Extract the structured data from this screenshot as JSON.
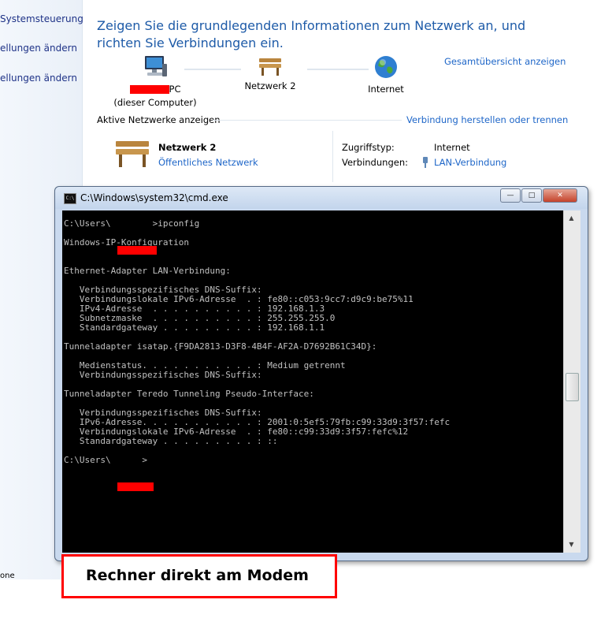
{
  "sidebar": {
    "items": [
      {
        "label": "Systemsteuerung"
      },
      {
        "label": "ellungen ändern"
      },
      {
        "label": "ellungen ändern"
      },
      {
        "label": "one"
      }
    ]
  },
  "main": {
    "title": "Zeigen Sie die grundlegenden Informationen zum Netzwerk an, und richten Sie Verbindungen ein.",
    "overview_link": "Gesamtübersicht anzeigen",
    "nodes": {
      "computer_label": "PC",
      "computer_sub": "(dieser Computer)",
      "network_label": "Netzwerk  2",
      "internet_label": "Internet"
    },
    "active_networks_header": "Aktive Netzwerke anzeigen",
    "connect_link": "Verbindung herstellen oder trennen",
    "network": {
      "name": "Netzwerk  2",
      "type_link": "Öffentliches Netzwerk",
      "access_type_label": "Zugriffstyp:",
      "access_type_value": "Internet",
      "connections_label": "Verbindungen:",
      "connections_value": "LAN-Verbindung"
    }
  },
  "cmd": {
    "title": "C:\\Windows\\system32\\cmd.exe",
    "icon_text": "C:\\",
    "minimize": "—",
    "maximize": "□",
    "close": "✕",
    "output": "C:\\Users\\        >ipconfig\n\nWindows-IP-Konfiguration\n\n\nEthernet-Adapter LAN-Verbindung:\n\n   Verbindungsspezifisches DNS-Suffix:\n   Verbindungslokale IPv6-Adresse  . : fe80::c053:9cc7:d9c9:be75%11\n   IPv4-Adresse  . . . . . . . . . . : 192.168.1.3\n   Subnetzmaske  . . . . . . . . . . : 255.255.255.0\n   Standardgateway . . . . . . . . . : 192.168.1.1\n\nTunneladapter isatap.{F9DA2813-D3F8-4B4F-AF2A-D7692B61C34D}:\n\n   Medienstatus. . . . . . . . . . . : Medium getrennt\n   Verbindungsspezifisches DNS-Suffix:\n\nTunneladapter Teredo Tunneling Pseudo-Interface:\n\n   Verbindungsspezifisches DNS-Suffix:\n   IPv6-Adresse. . . . . . . . . . . : 2001:0:5ef5:79fb:c99:33d9:3f57:fefc\n   Verbindungslokale IPv6-Adresse  . : fe80::c99:33d9:3f57:fefc%12\n   Standardgateway . . . . . . . . . : ::\n\nC:\\Users\\      >"
  },
  "caption": "Rechner direkt am Modem",
  "colors": {
    "link": "#1e66c8",
    "title_blue": "#1e5ba8",
    "redaction": "#ff0000",
    "console_bg": "#000000",
    "console_fg": "#c0c0c0"
  }
}
